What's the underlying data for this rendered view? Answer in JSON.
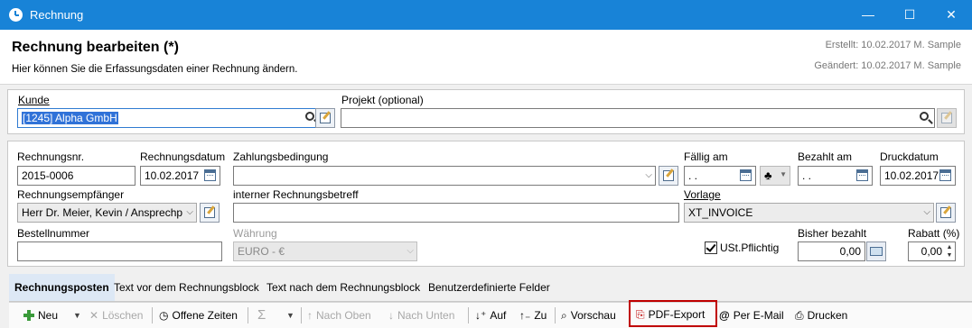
{
  "window": {
    "title": "Rechnung",
    "minimize": "—",
    "maximize": "☐",
    "close": "✕"
  },
  "header": {
    "title": "Rechnung bearbeiten (*)",
    "subtitle": "Hier können Sie die Erfassungsdaten einer Rechnung ändern.",
    "created": "Erstellt: 10.02.2017 M. Sample",
    "changed": "Geändert: 10.02.2017 M. Sample"
  },
  "customer": {
    "label": "Kunde",
    "value": "[1245] Alpha GmbH"
  },
  "project": {
    "label": "Projekt (optional)",
    "value": ""
  },
  "invoice": {
    "number_label": "Rechnungsnr.",
    "number": "2015-0006",
    "date_label": "Rechnungsdatum",
    "date": "10.02.2017",
    "terms_label": "Zahlungsbedingung",
    "terms": "",
    "due_label": "Fällig am",
    "due": " .  .",
    "paid_label": "Bezahlt am",
    "paid": " .  .",
    "print_label": "Druckdatum",
    "print": "10.02.2017",
    "recipient_label": "Rechnungsempfänger",
    "recipient": "Herr Dr. Meier, Kevin / Ansprechp",
    "subject_label": "interner Rechnungsbetreff",
    "subject": "",
    "template_label": "Vorlage",
    "template": "XT_INVOICE",
    "order_label": "Bestellnummer",
    "order": "",
    "currency_label": "Währung",
    "currency": "EURO - €",
    "vat_label": "USt.Pflichtig",
    "vat_checked": true,
    "paid_so_far_label": "Bisher bezahlt",
    "paid_so_far": "0,00",
    "discount_label": "Rabatt (%)",
    "discount": "0,00"
  },
  "tabs": [
    {
      "label": "Rechnungsposten"
    },
    {
      "label": "Text vor dem Rechnungsblock"
    },
    {
      "label": "Text nach dem Rechnungsblock"
    },
    {
      "label": "Benutzerdefinierte Felder"
    }
  ],
  "toolbar": {
    "new": "Neu",
    "delete": "Löschen",
    "open_times": "Offene Zeiten",
    "sum": "Σ",
    "up": "Nach Oben",
    "down": "Nach Unten",
    "asc": "Auf",
    "desc": "Zu",
    "preview": "Vorschau",
    "pdf": "PDF-Export",
    "email": "Per E-Mail",
    "print": "Drucken"
  },
  "colors": {
    "titlebar": "#1883d7",
    "highlight": "#c00000",
    "selection": "#3072d8"
  }
}
